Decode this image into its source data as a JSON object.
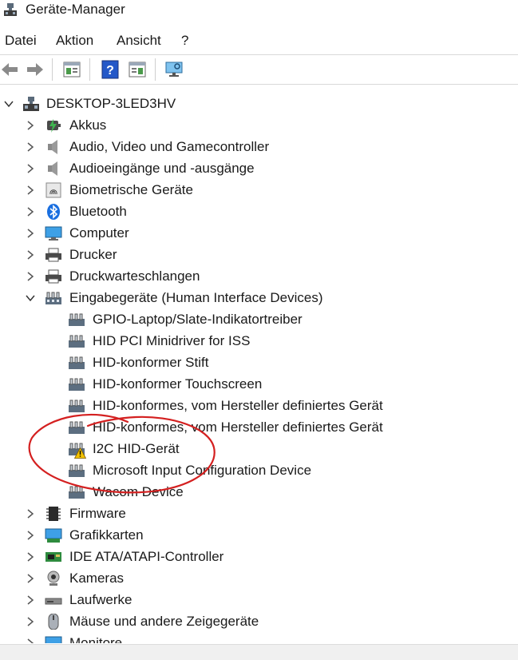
{
  "window": {
    "title": "Geräte-Manager"
  },
  "menu": [
    "Datei",
    "Aktion",
    "Ansicht",
    "?"
  ],
  "toolbar": {
    "buttons": [
      "back-arrow-icon",
      "forward-arrow-icon",
      "properties-icon",
      "help-icon",
      "show-hidden-icon",
      "scan-hardware-icon"
    ]
  },
  "tree": {
    "root": "DESKTOP-3LED3HV",
    "categories": [
      {
        "label": "Akkus",
        "icon": "battery-icon"
      },
      {
        "label": "Audio, Video und Gamecontroller",
        "icon": "speaker-icon"
      },
      {
        "label": "Audioeingänge und -ausgänge",
        "icon": "speaker-icon"
      },
      {
        "label": "Biometrische Geräte",
        "icon": "fingerprint-icon"
      },
      {
        "label": "Bluetooth",
        "icon": "bluetooth-icon"
      },
      {
        "label": "Computer",
        "icon": "monitor-icon"
      },
      {
        "label": "Drucker",
        "icon": "printer-icon"
      },
      {
        "label": "Druckwarteschlangen",
        "icon": "printer-icon"
      },
      {
        "label": "Eingabegeräte (Human Interface Devices)",
        "icon": "hid-icon",
        "expanded": true
      },
      {
        "label": "Firmware",
        "icon": "chip-icon"
      },
      {
        "label": "Grafikkarten",
        "icon": "display-adapter-icon"
      },
      {
        "label": "IDE ATA/ATAPI-Controller",
        "icon": "controller-icon"
      },
      {
        "label": "Kameras",
        "icon": "camera-icon"
      },
      {
        "label": "Laufwerke",
        "icon": "drive-icon"
      },
      {
        "label": "Mäuse und andere Zeigegeräte",
        "icon": "mouse-icon"
      },
      {
        "label": "Monitore",
        "icon": "monitor-icon"
      }
    ],
    "hid_children": [
      {
        "label": "GPIO-Laptop/Slate-Indikatortreiber"
      },
      {
        "label": "HID PCI Minidriver for ISS"
      },
      {
        "label": "HID-konformer Stift"
      },
      {
        "label": "HID-konformer Touchscreen"
      },
      {
        "label": "HID-konformes, vom Hersteller definiertes Gerät"
      },
      {
        "label": "HID-konformes, vom Hersteller definiertes Gerät"
      },
      {
        "label": "I2C HID-Gerät",
        "warning": true
      },
      {
        "label": "Microsoft Input Configuration Device"
      },
      {
        "label": "Wacom Device"
      }
    ]
  },
  "colors": {
    "annotation": "#d42020",
    "warning": "#f2c200",
    "selection": "#cce8ff"
  }
}
